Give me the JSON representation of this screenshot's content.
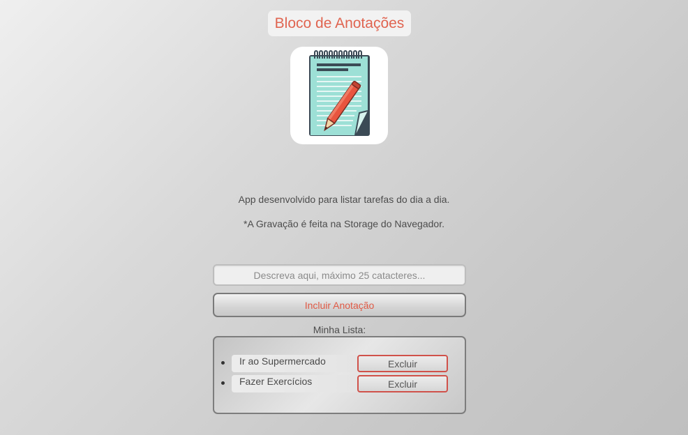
{
  "header": {
    "title": "Bloco de Anotações"
  },
  "logo": {
    "icon": "notepad-pencil-icon"
  },
  "description": {
    "line1": "App desenvolvido para listar tarefas do dia a dia.",
    "line2": "*A Gravação é feita na Storage do Navegador."
  },
  "form": {
    "input_value": "",
    "input_placeholder": "Descreva aqui, máximo 25 catacteres...",
    "add_label": "Incluir Anotação"
  },
  "list": {
    "title": "Minha Lista:",
    "items": [
      {
        "text": "Ir ao Supermercado",
        "delete_label": "Excluir"
      },
      {
        "text": "Fazer Exercícios",
        "delete_label": "Excluir"
      }
    ]
  },
  "colors": {
    "accent": "#e06450",
    "delete_border": "#d0514a"
  }
}
